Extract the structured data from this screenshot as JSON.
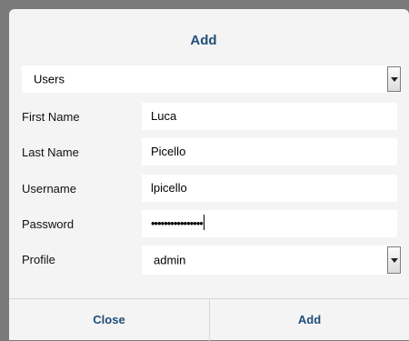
{
  "dialog": {
    "title": "Add"
  },
  "type_select": {
    "value": "Users"
  },
  "form": {
    "first_name": {
      "label": "First Name",
      "value": "Luca"
    },
    "last_name": {
      "label": "Last Name",
      "value": "Picello"
    },
    "username": {
      "label": "Username",
      "value": "lpicello"
    },
    "password": {
      "label": "Password",
      "value": "••••••••••••••••"
    },
    "profile": {
      "label": "Profile",
      "value": "admin"
    }
  },
  "footer": {
    "close_label": "Close",
    "add_label": "Add"
  },
  "colors": {
    "accent": "#1f4e78",
    "dialog_bg": "#f4f4f4",
    "backdrop": "#7a7a7a"
  },
  "icons": {
    "dropdown": "chevron-down-icon"
  }
}
